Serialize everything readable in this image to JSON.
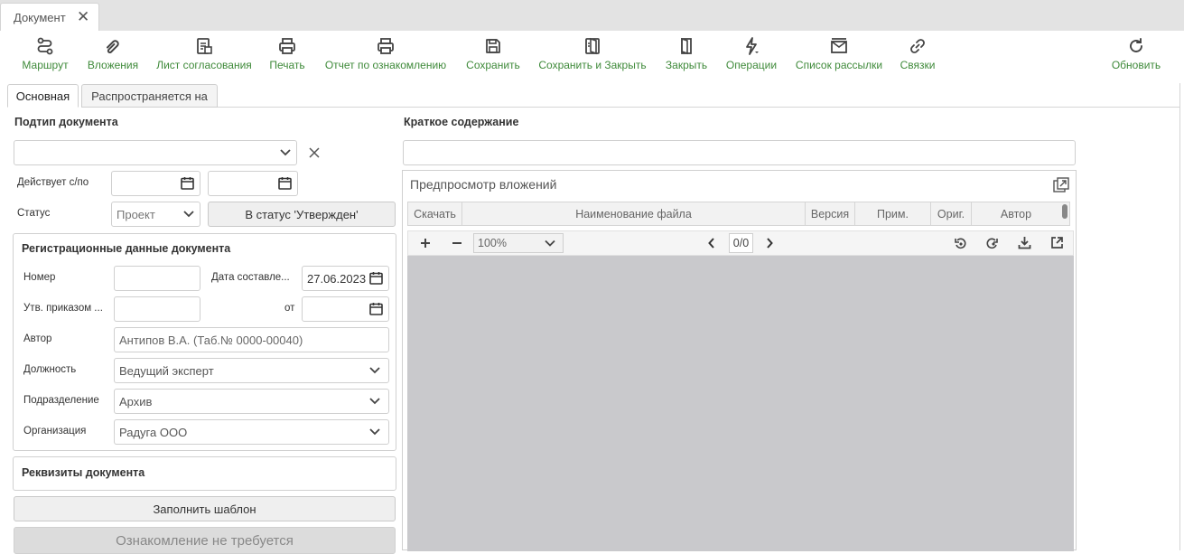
{
  "tab": {
    "title": "Документ"
  },
  "toolbar": {
    "route": "Маршрут",
    "attachments": "Вложения",
    "approval_sheet": "Лист согласования",
    "print": "Печать",
    "report": "Отчет по ознакомлению",
    "save": "Сохранить",
    "save_close": "Сохранить и Закрыть",
    "close": "Закрыть",
    "operations": "Операции",
    "mailing": "Список рассылки",
    "links": "Связки",
    "refresh": "Обновить"
  },
  "form_tabs": {
    "main": "Основная",
    "applies": "Распространяется на"
  },
  "left": {
    "subtype_label": "Подтип документа",
    "subtype_value": "",
    "valid_label": "Действует с/по",
    "status_label": "Статус",
    "status_value": "Проект",
    "to_approved_button": "В статус 'Утвержден'",
    "reg_title": "Регистрационные данные документа",
    "number_label": "Номер",
    "date_label": "Дата составле...",
    "date_value": "27.06.2023",
    "order_label": "Утв. приказом ...",
    "from_label": "от",
    "author_label": "Автор",
    "author_value": "Антипов В.А. (Таб.№ 0000-00040)",
    "position_label": "Должность",
    "position_value": "Ведущий эксперт",
    "department_label": "Подразделение",
    "department_value": "Архив",
    "org_label": "Организация",
    "org_value": "Радуга ООО",
    "requisites_title": "Реквизиты документа",
    "fill_template_button": "Заполнить шаблон",
    "no_familiarization_button": "Ознакомление не требуется"
  },
  "right": {
    "summary_label": "Краткое содержание",
    "summary_value": "",
    "preview_title": "Предпросмотр вложений",
    "columns": [
      "Скачать",
      "Наименование файла",
      "Версия",
      "Прим.",
      "Ориг.",
      "Автор"
    ],
    "zoom": "100%",
    "page": "0/0"
  },
  "colors": {
    "accent": "#3f8a3a",
    "tabstrip": "#e3e3e3",
    "viewer": "#c9c9cc"
  }
}
